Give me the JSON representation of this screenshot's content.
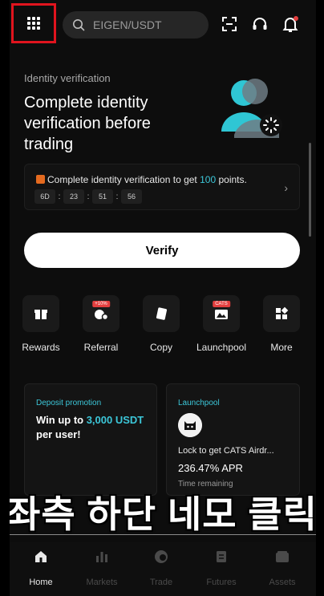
{
  "search": {
    "placeholder": "EIGEN/USDT"
  },
  "icons": {
    "menu": "grid-icon",
    "search": "search-icon",
    "scan": "scan-icon",
    "support": "headset-icon",
    "notifications": "bell-icon"
  },
  "colors": {
    "accent": "#3cc7d9",
    "highlight_box": "#e0141e",
    "background": "#0d0d0d"
  },
  "hero": {
    "subtitle": "Identity verification",
    "title": "Complete identity verification before trading",
    "promo_prefix": "Complete identity verification to get ",
    "promo_points": "100",
    "promo_suffix": " points.",
    "timer": [
      "6D",
      "23",
      "51",
      "56"
    ],
    "verify_label": "Verify"
  },
  "shortcuts": [
    {
      "label": "Rewards",
      "icon": "gift-icon"
    },
    {
      "label": "Referral",
      "icon": "referral-icon",
      "badge": "+10%"
    },
    {
      "label": "Copy",
      "icon": "copy-icon"
    },
    {
      "label": "Launchpool",
      "icon": "launchpool-icon",
      "badge": "CATS"
    },
    {
      "label": "More",
      "icon": "more-apps-icon"
    }
  ],
  "cards": {
    "deposit": {
      "subtitle": "Deposit promotion",
      "text_prefix": "Win up to ",
      "amount": "3,000 USDT",
      "text_suffix": " per user!"
    },
    "launchpool": {
      "subtitle": "Launchpool",
      "lock_text": "Lock to get CATS Airdr...",
      "apr": "236.47% APR",
      "time_label": "Time remaining"
    }
  },
  "caption": "좌측 하단 네모 클릭",
  "nav": [
    {
      "label": "Home",
      "icon": "home-icon",
      "active": true
    },
    {
      "label": "Markets",
      "icon": "markets-icon",
      "active": false
    },
    {
      "label": "Trade",
      "icon": "trade-icon",
      "active": false
    },
    {
      "label": "Futures",
      "icon": "futures-icon",
      "active": false
    },
    {
      "label": "Assets",
      "icon": "assets-icon",
      "active": false
    }
  ]
}
